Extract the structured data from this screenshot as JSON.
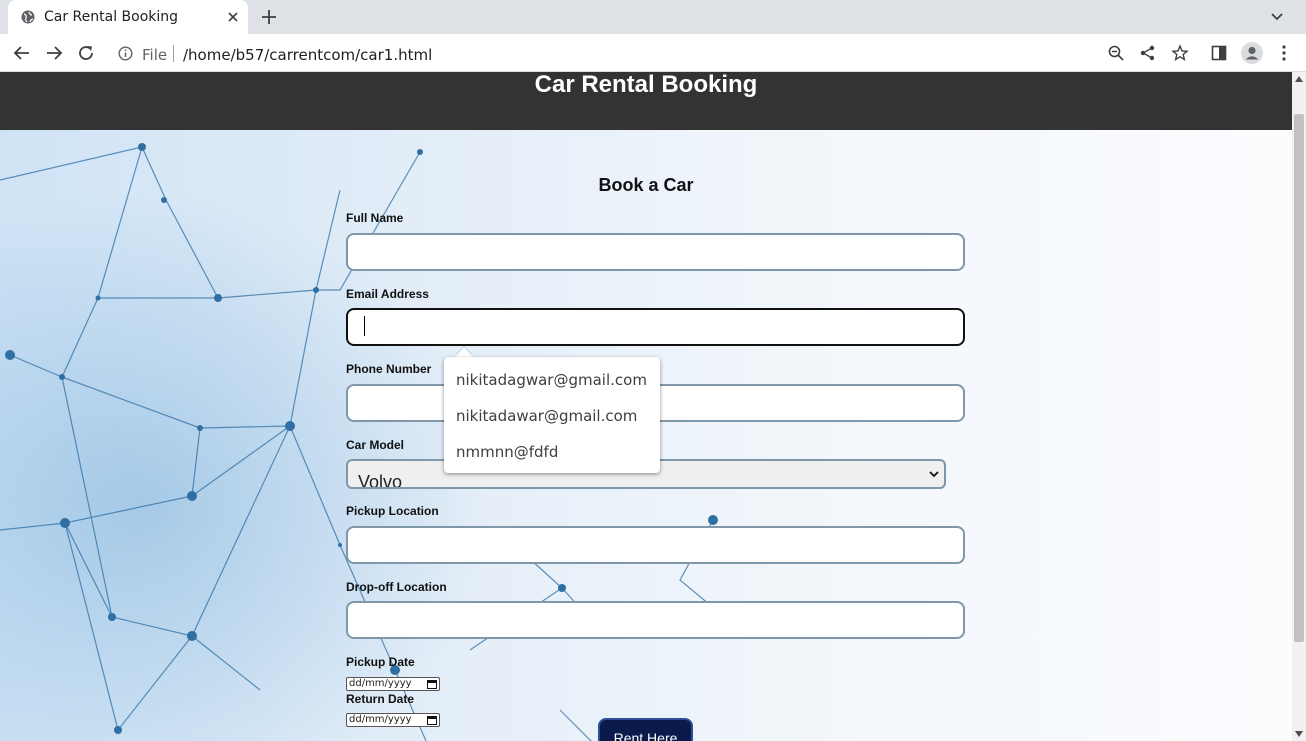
{
  "browser": {
    "tab_title": "Car Rental Booking",
    "url_scheme": "File",
    "url": "/home/b57/carrentcom/car1.html"
  },
  "page": {
    "header_title": "Car Rental Booking",
    "form_heading": "Book a Car",
    "fields": {
      "full_name": {
        "label": "Full Name",
        "value": ""
      },
      "email": {
        "label": "Email Address",
        "value": ""
      },
      "phone": {
        "label": "Phone Number",
        "value": ""
      },
      "car_model": {
        "label": "Car Model",
        "selected": "Volvo"
      },
      "pickup_location": {
        "label": "Pickup Location",
        "value": ""
      },
      "dropoff_location": {
        "label": "Drop-off Location",
        "value": ""
      },
      "pickup_date": {
        "label": "Pickup Date",
        "placeholder": "dd/mm/yyyy"
      },
      "return_date": {
        "label": "Return Date",
        "placeholder": "dd/mm/yyyy"
      }
    },
    "submit_label": "Rent Here"
  },
  "autofill_suggestions": [
    "nikitadagwar@gmail.com",
    "nikitadawar@gmail.com",
    "nmmnn@fdfd"
  ],
  "colors": {
    "header_bg": "#333333",
    "button_bg": "#0a1a4a",
    "input_border": "#7f97a8"
  }
}
